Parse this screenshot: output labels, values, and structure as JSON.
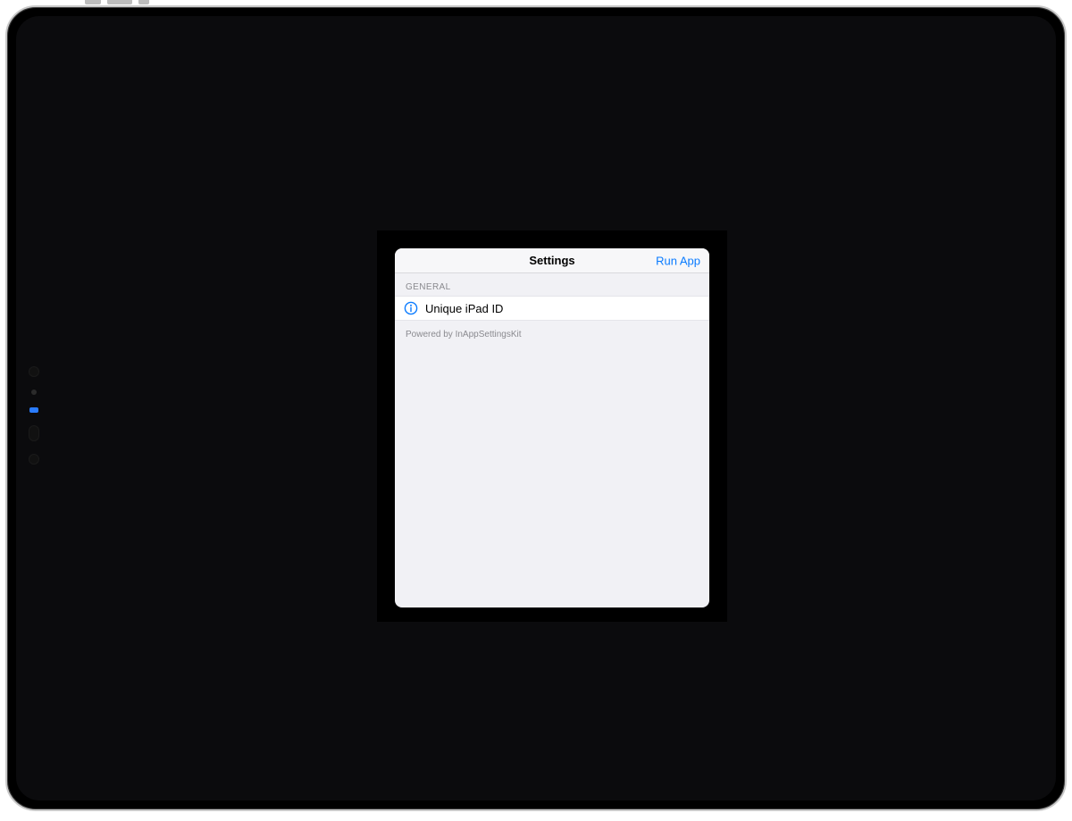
{
  "colors": {
    "accent": "#0a7bff",
    "screenBg": "#0b0b0d"
  },
  "modal": {
    "title": "Settings",
    "action": "Run App",
    "sections": [
      {
        "header": "GENERAL",
        "rows": [
          {
            "icon": "info-icon",
            "label": "Unique iPad ID"
          }
        ]
      }
    ],
    "footer": "Powered by InAppSettingsKit"
  }
}
